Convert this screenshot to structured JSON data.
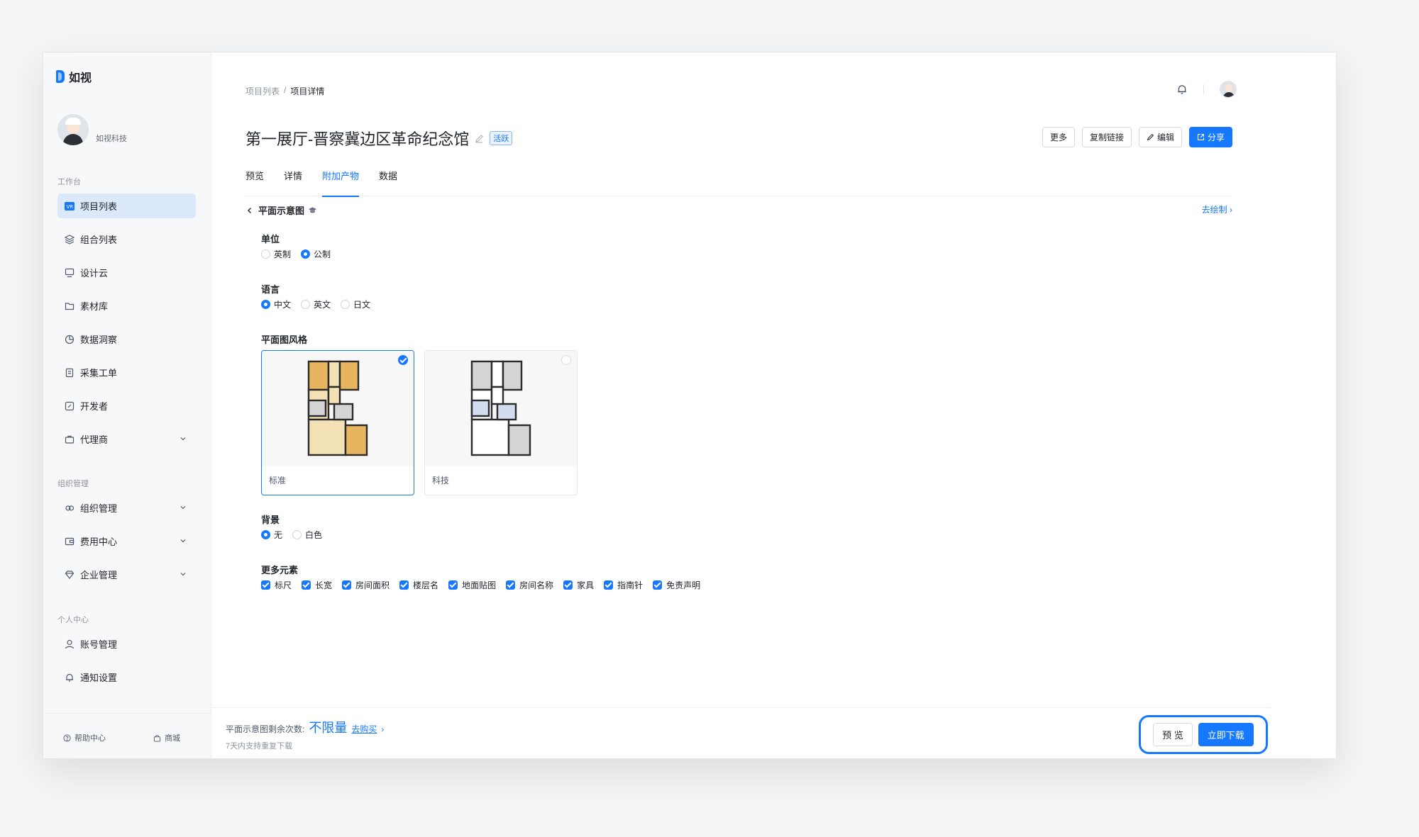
{
  "app": {
    "name": "如视"
  },
  "profile": {
    "company": "如视科技"
  },
  "sidebar": {
    "groups": [
      {
        "title": "工作台"
      },
      {
        "title": "组织管理"
      },
      {
        "title": "个人中心"
      }
    ],
    "items": [
      {
        "label": "项目列表",
        "icon": "vr-icon"
      },
      {
        "label": "组合列表",
        "icon": "layers-icon"
      },
      {
        "label": "设计云",
        "icon": "monitor-icon"
      },
      {
        "label": "素材库",
        "icon": "folder-icon"
      },
      {
        "label": "数据洞察",
        "icon": "pie-chart-icon"
      },
      {
        "label": "采集工单",
        "icon": "document-icon"
      },
      {
        "label": "开发者",
        "icon": "developer-icon"
      },
      {
        "label": "代理商",
        "icon": "briefcase-icon"
      },
      {
        "label": "组织管理",
        "icon": "org-icon"
      },
      {
        "label": "费用中心",
        "icon": "wallet-icon"
      },
      {
        "label": "企业管理",
        "icon": "diamond-icon"
      },
      {
        "label": "账号管理",
        "icon": "user-icon"
      },
      {
        "label": "通知设置",
        "icon": "bell-icon"
      }
    ],
    "footer": {
      "help": "帮助中心",
      "shop": "商城"
    }
  },
  "breadcrumb": {
    "parent": "项目列表",
    "separator": "/",
    "current": "项目详情"
  },
  "header": {
    "title": "第一展厅-晋察冀边区革命纪念馆",
    "status": "活跃",
    "actions": {
      "more": "更多",
      "copy_link": "复制链接",
      "edit": "编辑",
      "share": "分享"
    }
  },
  "tabs": [
    "预览",
    "详情",
    "附加产物",
    "数据"
  ],
  "section": {
    "title": "平面示意图",
    "draw_link": "去绘制"
  },
  "form": {
    "unit": {
      "label": "单位",
      "options": [
        "英制",
        "公制"
      ],
      "selected": "公制"
    },
    "language": {
      "label": "语言",
      "options": [
        "中文",
        "英文",
        "日文"
      ],
      "selected": "中文"
    },
    "style": {
      "label": "平面图风格",
      "options": [
        "标准",
        "科技"
      ],
      "selected": "标准"
    },
    "background": {
      "label": "背景",
      "options": [
        "无",
        "白色"
      ],
      "selected": "无"
    },
    "elements": {
      "label": "更多元素",
      "options": [
        "标尺",
        "长宽",
        "房间面积",
        "楼层名",
        "地面贴图",
        "房间名称",
        "家具",
        "指南针",
        "免责声明"
      ]
    }
  },
  "footer_bar": {
    "remain_label": "平面示意图剩余次数:",
    "remain_value": "不限量",
    "buy_link": "去购买",
    "note": "7天内支持重复下载",
    "preview": "预 览",
    "download": "立即下载"
  },
  "colors": {
    "accent": "#1677ff",
    "standard_floor": "#f2e2b5",
    "standard_room": "#e7b55f",
    "tech_room": "#d4dcf0"
  }
}
